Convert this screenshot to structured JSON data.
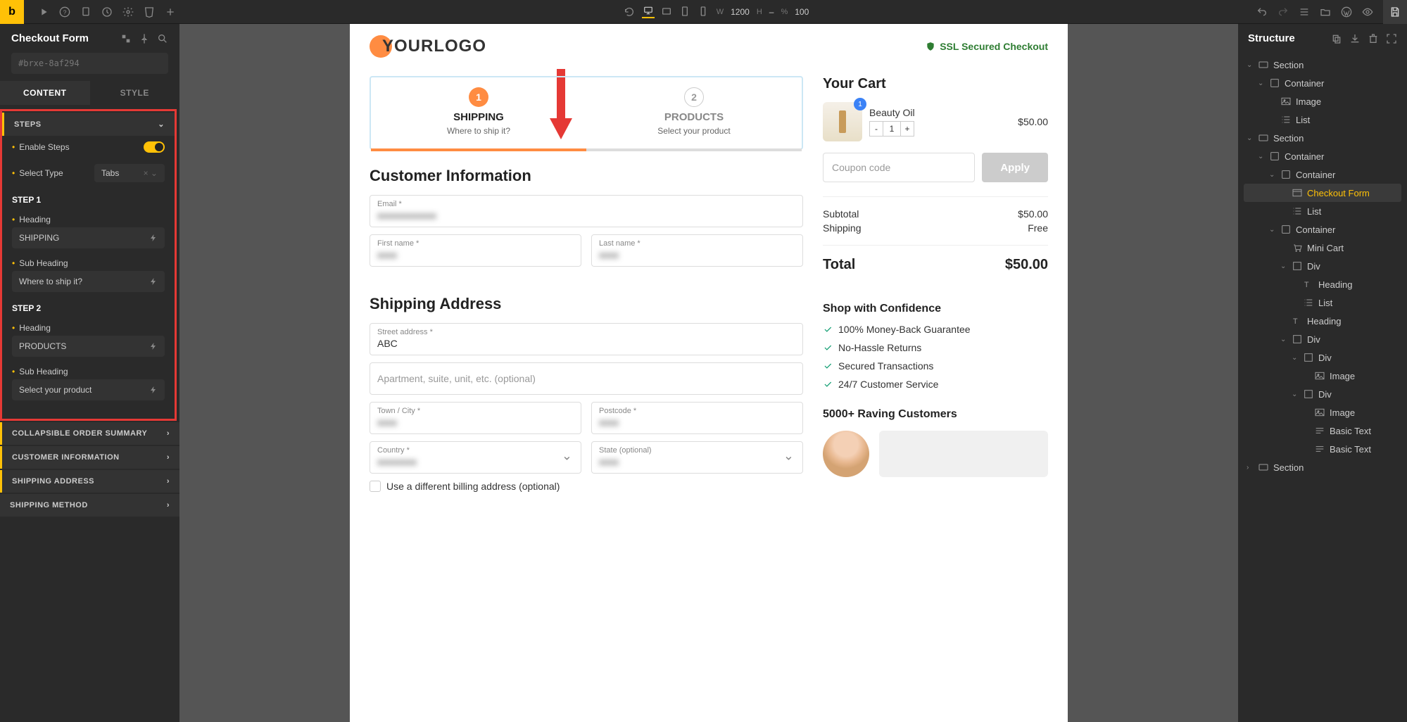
{
  "topbar": {
    "width_label": "W",
    "width_value": "1200",
    "height_label": "H",
    "height_value": "–",
    "zoom_label": "%",
    "zoom_value": "100"
  },
  "left_panel": {
    "title": "Checkout Form",
    "element_id": "#brxe-8af294",
    "tabs": {
      "content": "CONTENT",
      "style": "STYLE"
    },
    "sections": {
      "steps": "STEPS",
      "enable_steps": "Enable Steps",
      "select_type": "Select Type",
      "select_type_value": "Tabs",
      "step1_title": "STEP 1",
      "step2_title": "STEP 2",
      "heading_label": "Heading",
      "subheading_label": "Sub Heading",
      "step1_heading": "SHIPPING",
      "step1_sub": "Where to ship it?",
      "step2_heading": "PRODUCTS",
      "step2_sub": "Select your product",
      "collapsible": "COLLAPSIBLE ORDER SUMMARY",
      "customer_info": "CUSTOMER INFORMATION",
      "shipping_address": "SHIPPING ADDRESS",
      "shipping_method": "SHIPPING METHOD"
    }
  },
  "canvas": {
    "logo_text": "OURLOGO",
    "logo_first": "Y",
    "ssl_text": "SSL Secured Checkout",
    "steps": [
      {
        "num": "1",
        "title": "SHIPPING",
        "sub": "Where to ship it?"
      },
      {
        "num": "2",
        "title": "PRODUCTS",
        "sub": "Select your product"
      }
    ],
    "customer_info_title": "Customer Information",
    "fields": {
      "email": "Email *",
      "first_name": "First name *",
      "last_name": "Last name *"
    },
    "shipping_title": "Shipping Address",
    "addr": {
      "street": "Street address *",
      "street_val": "ABC",
      "apt": "Apartment, suite, unit, etc. (optional)",
      "city": "Town / City *",
      "postcode": "Postcode *",
      "country": "Country *",
      "state": "State (optional)"
    },
    "diff_billing": "Use a different billing address (optional)",
    "cart": {
      "title": "Your Cart",
      "product": "Beauty Oil",
      "price": "$50.00",
      "qty": "1",
      "badge": "1",
      "coupon_placeholder": "Coupon code",
      "apply": "Apply",
      "subtotal_label": "Subtotal",
      "subtotal": "$50.00",
      "shipping_label": "Shipping",
      "shipping": "Free",
      "total_label": "Total",
      "total": "$50.00"
    },
    "trust": {
      "title": "Shop with Confidence",
      "items": [
        "100% Money-Back Guarantee",
        "No-Hassle Returns",
        "Secured Transactions",
        "24/7 Customer Service"
      ]
    },
    "raving": "5000+ Raving Customers"
  },
  "structure": {
    "title": "Structure",
    "tree": [
      {
        "indent": 0,
        "caret": "v",
        "type": "section",
        "label": "Section"
      },
      {
        "indent": 1,
        "caret": "v",
        "type": "container",
        "label": "Container"
      },
      {
        "indent": 2,
        "caret": "",
        "type": "image",
        "label": "Image"
      },
      {
        "indent": 2,
        "caret": "",
        "type": "list",
        "label": "List"
      },
      {
        "indent": 0,
        "caret": "v",
        "type": "section",
        "label": "Section"
      },
      {
        "indent": 1,
        "caret": "v",
        "type": "container",
        "label": "Container"
      },
      {
        "indent": 2,
        "caret": "v",
        "type": "container",
        "label": "Container"
      },
      {
        "indent": 3,
        "caret": "",
        "type": "checkout",
        "label": "Checkout Form",
        "selected": true
      },
      {
        "indent": 3,
        "caret": "",
        "type": "list",
        "label": "List"
      },
      {
        "indent": 2,
        "caret": "v",
        "type": "container",
        "label": "Container"
      },
      {
        "indent": 3,
        "caret": "",
        "type": "cart",
        "label": "Mini Cart"
      },
      {
        "indent": 3,
        "caret": "v",
        "type": "div",
        "label": "Div"
      },
      {
        "indent": 4,
        "caret": "",
        "type": "heading",
        "label": "Heading"
      },
      {
        "indent": 4,
        "caret": "",
        "type": "list",
        "label": "List"
      },
      {
        "indent": 3,
        "caret": "",
        "type": "heading",
        "label": "Heading"
      },
      {
        "indent": 3,
        "caret": "v",
        "type": "div",
        "label": "Div"
      },
      {
        "indent": 4,
        "caret": "v",
        "type": "div",
        "label": "Div"
      },
      {
        "indent": 4,
        "caret": "",
        "type": "image",
        "label": "Image",
        "offset": true
      },
      {
        "indent": 4,
        "caret": "v",
        "type": "div",
        "label": "Div"
      },
      {
        "indent": 4,
        "caret": "",
        "type": "image",
        "label": "Image",
        "offset": true
      },
      {
        "indent": 4,
        "caret": "",
        "type": "text",
        "label": "Basic Text",
        "offset": true
      },
      {
        "indent": 4,
        "caret": "",
        "type": "text",
        "label": "Basic Text",
        "offset": true
      },
      {
        "indent": 0,
        "caret": ">",
        "type": "section",
        "label": "Section"
      }
    ]
  }
}
